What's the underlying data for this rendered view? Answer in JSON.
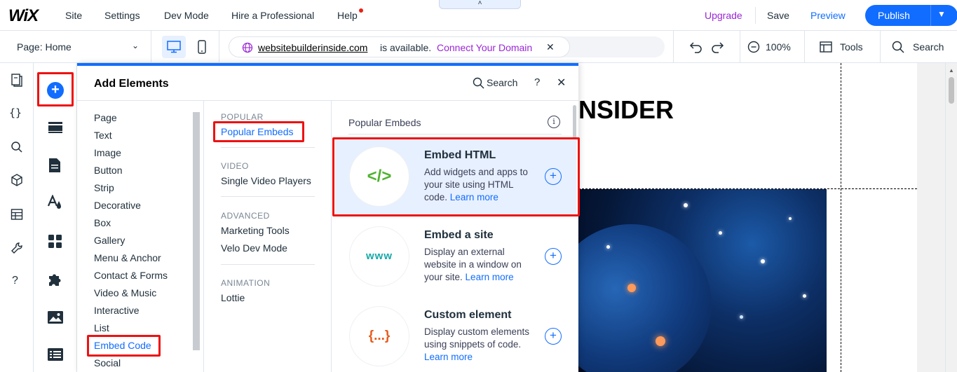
{
  "topbar": {
    "logo": "WiX",
    "menu": [
      "Site",
      "Settings",
      "Dev Mode",
      "Hire a Professional",
      "Help"
    ],
    "collapse_glyph": "˄",
    "upgrade": "Upgrade",
    "save": "Save",
    "preview": "Preview",
    "publish": "Publish"
  },
  "secondbar": {
    "page_selector": "Page: Home",
    "domain_name": "websitebuilderinside.com",
    "domain_status": "is available.",
    "connect_domain": "Connect Your Domain",
    "zoom": "100%",
    "tools": "Tools",
    "search": "Search"
  },
  "panel": {
    "title": "Add Elements",
    "search": "Search",
    "help": "?",
    "close": "✕",
    "categories": [
      "Page",
      "Text",
      "Image",
      "Button",
      "Strip",
      "Decorative",
      "Box",
      "Gallery",
      "Menu & Anchor",
      "Contact & Forms",
      "Video & Music",
      "Interactive",
      "List",
      "Embed Code",
      "Social"
    ],
    "active_category": "Embed Code",
    "subcategories": {
      "popular_header": "POPULAR",
      "popular": [
        "Popular Embeds"
      ],
      "video_header": "VIDEO",
      "video": [
        "Single Video Players"
      ],
      "advanced_header": "ADVANCED",
      "advanced": [
        "Marketing Tools",
        "Velo Dev Mode"
      ],
      "animation_header": "ANIMATION",
      "animation": [
        "Lottie"
      ]
    },
    "section_title": "Popular Embeds",
    "info_glyph": "i",
    "cards": [
      {
        "title": "Embed HTML",
        "desc": "Add widgets and apps to your site using HTML code.",
        "learn_more": "Learn more",
        "icon_text": "</>",
        "icon_color": "#4eb32e"
      },
      {
        "title": "Embed a site",
        "desc": "Display an external website in a window on your site.",
        "learn_more": "Learn more",
        "icon_text": "www",
        "icon_color": "#16a8a8"
      },
      {
        "title": "Custom element",
        "desc": "Display custom elements using snippets of code.",
        "learn_more": "Learn more",
        "icon_text": "{...}",
        "icon_color": "#e8591a"
      }
    ]
  },
  "canvas": {
    "site_title": "NSIDER"
  },
  "colors": {
    "accent": "#116dff",
    "upgrade": "#9a27d5",
    "highlight": "#ee1111"
  }
}
